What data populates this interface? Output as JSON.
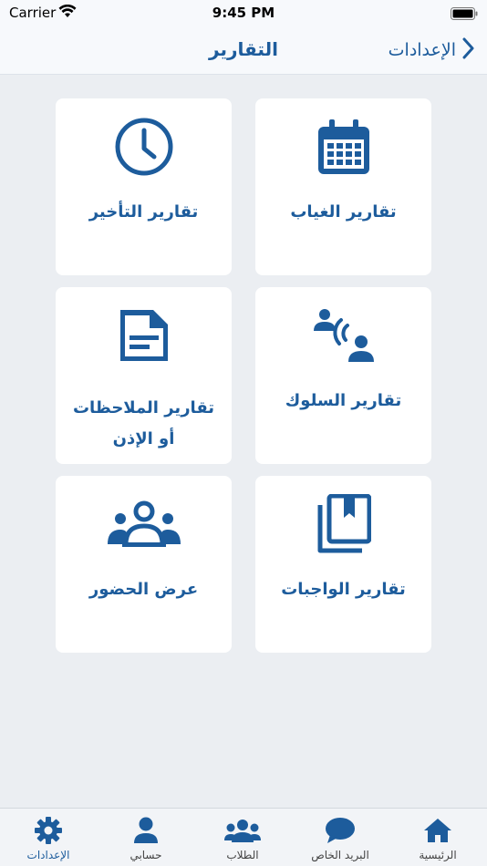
{
  "status_bar": {
    "carrier": "Carrier",
    "time": "9:45 PM"
  },
  "nav": {
    "title": "التقارير",
    "back_label": "الإعدادات"
  },
  "cards": [
    {
      "label": "تقارير الغياب",
      "icon": "calendar-icon"
    },
    {
      "label": "تقارير التأخير",
      "icon": "clock-icon"
    },
    {
      "label": "تقارير السلوك",
      "icon": "behavior-icon"
    },
    {
      "label": "تقارير الملاحظات أو الإذن",
      "icon": "document-icon"
    },
    {
      "label": "تقارير الواجبات",
      "icon": "homework-icon"
    },
    {
      "label": "عرض الحضور",
      "icon": "attendance-group-icon"
    }
  ],
  "tabs": [
    {
      "label": "الرئيسية",
      "icon": "home-icon"
    },
    {
      "label": "البريد الخاص",
      "icon": "chat-bubble-icon"
    },
    {
      "label": "الطلاب",
      "icon": "students-icon"
    },
    {
      "label": "حسابي",
      "icon": "person-icon"
    },
    {
      "label": "الإعدادات",
      "icon": "gear-icon",
      "active": true
    }
  ],
  "colors": {
    "accent": "#1d5c9c",
    "background": "#ebeef2",
    "card": "#ffffff"
  }
}
